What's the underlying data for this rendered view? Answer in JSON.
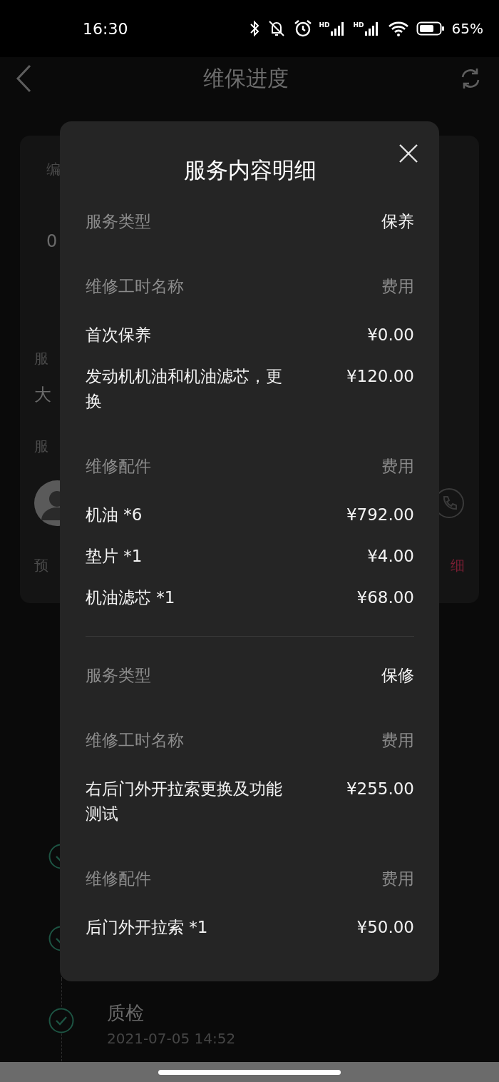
{
  "status_bar": {
    "time": "16:30",
    "signal_labels": [
      "HD",
      "HD"
    ],
    "battery": "65%"
  },
  "header": {
    "title": "维保进度"
  },
  "card": {
    "number_label": "编",
    "number": "0",
    "service_label": "服",
    "service_value": "大",
    "advisor_label": "服",
    "estimate_label": "预",
    "detail_link": "细"
  },
  "timeline": [
    {
      "done": true
    },
    {
      "done": true
    },
    {
      "done": true,
      "title": "质检",
      "time": "2021-07-05 14:52"
    }
  ],
  "dialog": {
    "title": "服务内容明细",
    "sections": [
      {
        "rows": [
          {
            "kind": "type",
            "label": "服务类型",
            "value": "保养"
          },
          {
            "kind": "header",
            "label": "维修工时名称",
            "value": "费用"
          },
          {
            "kind": "item",
            "label": "首次保养",
            "value": "¥0.00"
          },
          {
            "kind": "item",
            "label": "发动机机油和机油滤芯，更换",
            "value": "¥120.00"
          },
          {
            "kind": "header",
            "label": "维修配件",
            "value": "费用"
          },
          {
            "kind": "item",
            "label": "机油 *6",
            "value": "¥792.00"
          },
          {
            "kind": "item",
            "label": "垫片 *1",
            "value": "¥4.00"
          },
          {
            "kind": "item",
            "label": "机油滤芯 *1",
            "value": "¥68.00"
          }
        ]
      },
      {
        "rows": [
          {
            "kind": "type",
            "label": "服务类型",
            "value": "保修"
          },
          {
            "kind": "header",
            "label": "维修工时名称",
            "value": "费用"
          },
          {
            "kind": "item",
            "label": "右后门外开拉索更换及功能测试",
            "value": "¥255.00"
          },
          {
            "kind": "header",
            "label": "维修配件",
            "value": "费用"
          },
          {
            "kind": "item",
            "label": "后门外开拉索 *1",
            "value": "¥50.00"
          }
        ]
      }
    ]
  }
}
